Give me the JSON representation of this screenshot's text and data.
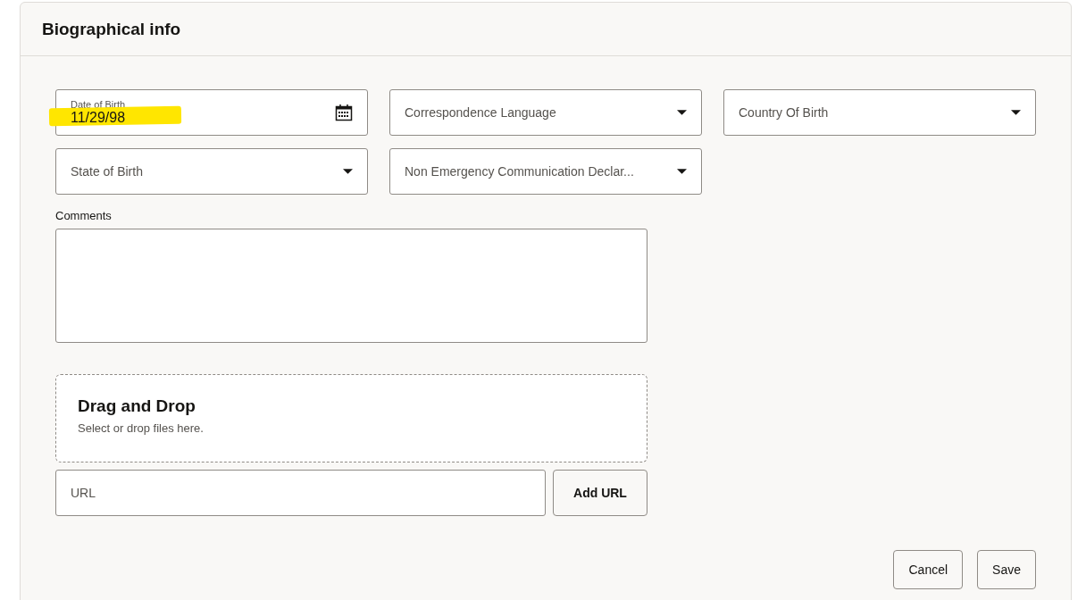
{
  "panel": {
    "title": "Biographical info"
  },
  "fields": [
    {
      "kind": "date",
      "label": "Date of Birth",
      "value": "11/29/98",
      "highlighted": true
    },
    {
      "kind": "select",
      "placeholder": "Correspondence Language"
    },
    {
      "kind": "select",
      "placeholder": "Country Of Birth"
    },
    {
      "kind": "select",
      "placeholder": "State of Birth"
    },
    {
      "kind": "select",
      "placeholder": "Non Emergency Communication Declar..."
    }
  ],
  "comments": {
    "label": "Comments"
  },
  "dropzone": {
    "title": "Drag and Drop",
    "hint": "Select or drop files here."
  },
  "url": {
    "placeholder": "URL",
    "button": "Add URL"
  },
  "actions": [
    "Cancel",
    "Save"
  ]
}
